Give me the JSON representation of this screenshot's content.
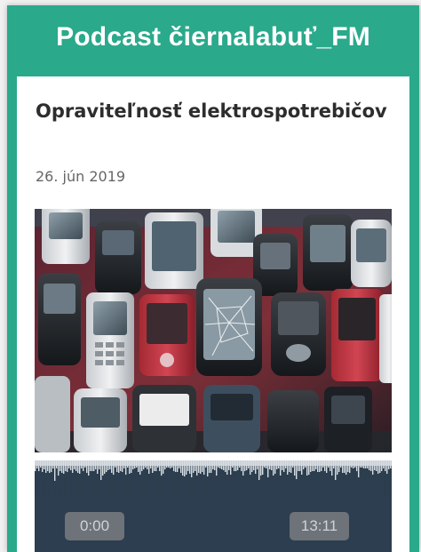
{
  "widget": {
    "title": "Podcast čiernalabuť_FM"
  },
  "episode": {
    "title": "Opraviteľnosť elektrospotrebičov",
    "date": "26. jún 2019",
    "image_icon": "broken-phones-cover-image"
  },
  "player": {
    "current_time": "0:00",
    "total_time": "13:11",
    "progress_fraction": 0,
    "colors": {
      "background": "#2c3e4f",
      "waveform": "#d7dde2",
      "time_box": "#6d7379"
    }
  },
  "colors": {
    "accent": "#2aa98b",
    "card": "#ffffff"
  }
}
